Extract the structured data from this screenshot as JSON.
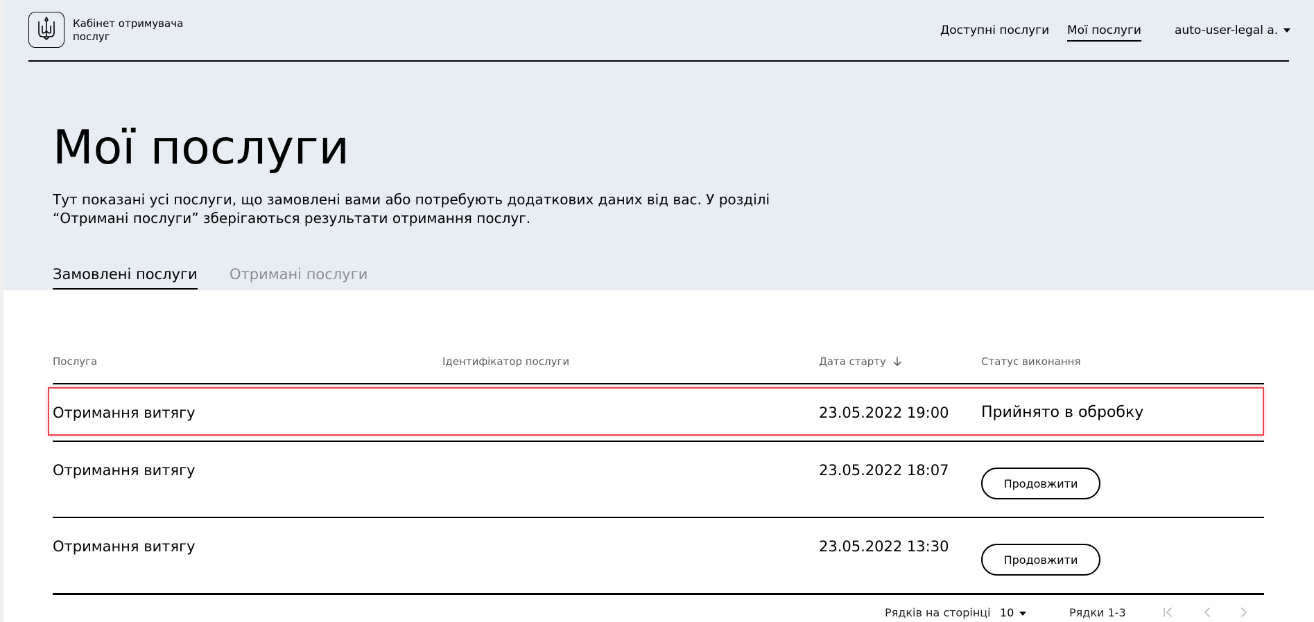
{
  "header": {
    "logo_icon": "trident-icon",
    "logo_text": "Кабінет отримувача послуг",
    "nav": {
      "available": "Доступні послуги",
      "my": "Мої послуги"
    },
    "user": "auto-user-legal a."
  },
  "page": {
    "title": "Мої послуги",
    "description": "Тут показані усі послуги, що замовлені вами або потребують додаткових даних від вас. У розділі “Отримані послуги” зберігаються результати отримання послуг."
  },
  "tabs": {
    "ordered": "Замовлені послуги",
    "received": "Отримані послуги"
  },
  "table": {
    "columns": {
      "service": "Послуга",
      "id": "Ідентифікатор послуги",
      "date": "Дата старту",
      "status": "Статус виконання"
    },
    "rows": [
      {
        "service": "Отримання витягу",
        "id": "",
        "date": "23.05.2022 19:00",
        "status": "Прийнято в обробку"
      },
      {
        "service": "Отримання витягу",
        "id": "",
        "date": "23.05.2022 18:07",
        "action": "Продовжити"
      },
      {
        "service": "Отримання витягу",
        "id": "",
        "date": "23.05.2022 13:30",
        "action": "Продовжити"
      }
    ]
  },
  "pagination": {
    "rows_per_page_label": "Рядків на сторінці",
    "rows_per_page_value": "10",
    "range_label": "Рядки 1-3"
  },
  "colors": {
    "header_bg": "#e7edf3",
    "text": "#000000",
    "muted_tab": "#8a8d91",
    "column_header": "#5b5f63",
    "highlight_border": "#e8424c"
  }
}
